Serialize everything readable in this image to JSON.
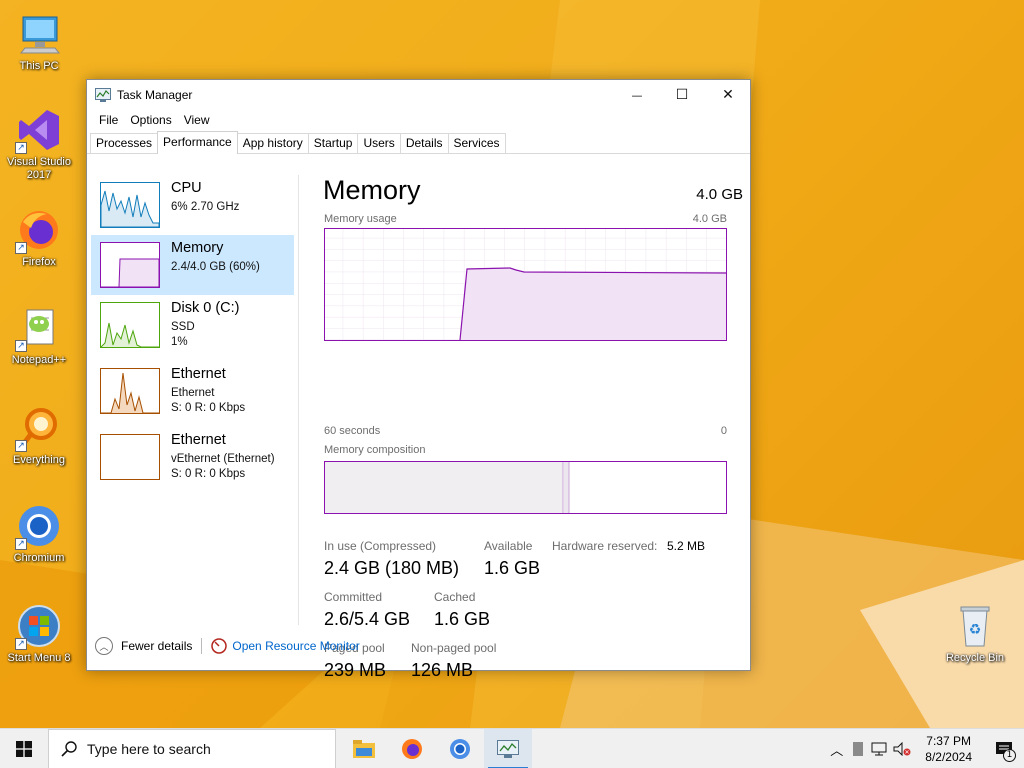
{
  "desktop": {
    "icons": [
      {
        "label": "This PC",
        "icon": "computer-icon"
      },
      {
        "label": "Visual Studio 2017",
        "icon": "visual-studio-icon"
      },
      {
        "label": "Firefox",
        "icon": "firefox-icon"
      },
      {
        "label": "Notepad++",
        "icon": "notepadpp-icon"
      },
      {
        "label": "Everything",
        "icon": "everything-icon"
      },
      {
        "label": "Chromium",
        "icon": "chromium-icon"
      },
      {
        "label": "Start Menu 8",
        "icon": "startmenu8-icon"
      },
      {
        "label": "Recycle Bin",
        "icon": "recycle-bin-icon"
      }
    ],
    "wallpaper_colors": {
      "base": "#f0a815",
      "accent": "#f7c44a",
      "light": "#fbe7c8"
    }
  },
  "window": {
    "title": "Task Manager",
    "controls": {
      "minimize": "—",
      "maximize": "☐",
      "close": "✕"
    },
    "menu": [
      "File",
      "Options",
      "View"
    ],
    "tabs": [
      "Processes",
      "Performance",
      "App history",
      "Startup",
      "Users",
      "Details",
      "Services"
    ],
    "active_tab": "Performance"
  },
  "sidebar": {
    "items": [
      {
        "name": "CPU",
        "line1": "6%  2.70 GHz",
        "line2": "",
        "color": "#117dbb"
      },
      {
        "name": "Memory",
        "line1": "2.4/4.0 GB (60%)",
        "line2": "",
        "color": "#8b12ae",
        "selected": true
      },
      {
        "name": "Disk 0 (C:)",
        "line1": "SSD",
        "line2": "1%",
        "color": "#4da60c"
      },
      {
        "name": "Ethernet",
        "line1": "Ethernet",
        "line2": "S: 0  R: 0 Kbps",
        "color": "#a74f01"
      },
      {
        "name": "Ethernet",
        "line1": "vEthernet (Ethernet)",
        "line2": "S: 0  R: 0 Kbps",
        "color": "#a74f01"
      }
    ]
  },
  "memory": {
    "title": "Memory",
    "total": "4.0 GB",
    "usage_label": "Memory usage",
    "usage_max": "4.0 GB",
    "time_label": "60 seconds",
    "time_end": "0",
    "composition_label": "Memory composition",
    "graph_color": "#8b12ae",
    "stats": {
      "in_use_label": "In use (Compressed)",
      "in_use_value": "2.4 GB (180 MB)",
      "available_label": "Available",
      "available_value": "1.6 GB",
      "hw_reserved_label": "Hardware reserved:",
      "hw_reserved_value": "5.2 MB",
      "committed_label": "Committed",
      "committed_value": "2.6/5.4 GB",
      "cached_label": "Cached",
      "cached_value": "1.6 GB",
      "paged_label": "Paged pool",
      "paged_value": "239 MB",
      "nonpaged_label": "Non-paged pool",
      "nonpaged_value": "126 MB"
    }
  },
  "footer": {
    "fewer_details": "Fewer details",
    "resource_monitor": "Open Resource Monitor"
  },
  "taskbar": {
    "search_placeholder": "Type here to search",
    "apps": [
      "file-explorer-icon",
      "firefox-icon",
      "chromium-icon",
      "task-manager-icon"
    ],
    "time": "7:37 PM",
    "date": "8/2/2024",
    "notification_count": "1"
  }
}
